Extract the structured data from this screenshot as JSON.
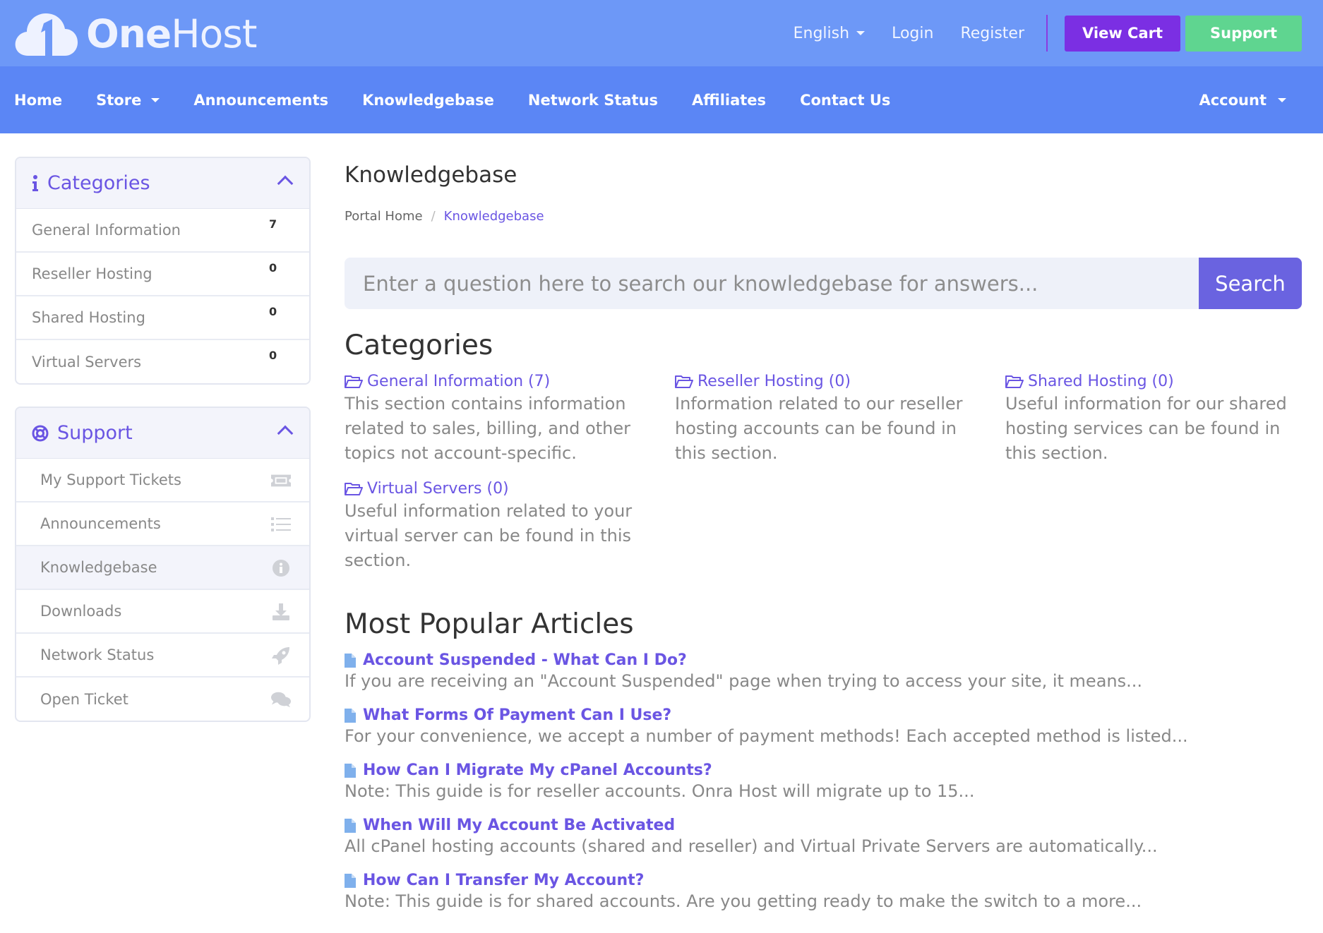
{
  "brand": {
    "name_bold": "One",
    "name_thin": "Host"
  },
  "topbar": {
    "language": "English",
    "login": "Login",
    "register": "Register",
    "view_cart": "View Cart",
    "support": "Support"
  },
  "nav": {
    "home": "Home",
    "store": "Store",
    "announcements": "Announcements",
    "knowledgebase": "Knowledgebase",
    "network_status": "Network Status",
    "affiliates": "Affiliates",
    "contact_us": "Contact Us",
    "account": "Account"
  },
  "sidebar": {
    "categories": {
      "title": "Categories",
      "items": [
        {
          "label": "General Information",
          "count": "7"
        },
        {
          "label": "Reseller Hosting",
          "count": "0"
        },
        {
          "label": "Shared Hosting",
          "count": "0"
        },
        {
          "label": "Virtual Servers",
          "count": "0"
        }
      ]
    },
    "support": {
      "title": "Support",
      "items": [
        {
          "label": "My Support Tickets",
          "icon": "ticket-icon"
        },
        {
          "label": "Announcements",
          "icon": "list-icon"
        },
        {
          "label": "Knowledgebase",
          "icon": "info-circle-icon"
        },
        {
          "label": "Downloads",
          "icon": "download-icon"
        },
        {
          "label": "Network Status",
          "icon": "rocket-icon"
        },
        {
          "label": "Open Ticket",
          "icon": "comments-icon"
        }
      ]
    }
  },
  "main": {
    "title": "Knowledgebase",
    "breadcrumb": {
      "home": "Portal Home",
      "current": "Knowledgebase"
    },
    "search": {
      "placeholder": "Enter a question here to search our knowledgebase for answers...",
      "button": "Search"
    },
    "categories_heading": "Categories",
    "categories": [
      {
        "title": "General Information (7)",
        "desc": "This section contains information related to sales, billing, and other topics not account-specific."
      },
      {
        "title": "Reseller Hosting (0)",
        "desc": "Information related to our reseller hosting accounts can be found in this section."
      },
      {
        "title": "Shared Hosting (0)",
        "desc": "Useful information for our shared hosting services can be found in this section."
      },
      {
        "title": "Virtual Servers (0)",
        "desc": "Useful information related to your virtual server can be found in this section."
      }
    ],
    "popular_heading": "Most Popular Articles",
    "articles": [
      {
        "title": "Account Suspended - What Can I Do?",
        "desc": "If you are receiving an \"Account Suspended\" page when trying to access your site, it means..."
      },
      {
        "title": "What Forms Of Payment Can I Use?",
        "desc": "For your convenience, we accept a number of payment methods! Each accepted method is listed..."
      },
      {
        "title": "How Can I Migrate My cPanel Accounts?",
        "desc": "Note: This guide is for reseller accounts.  Onra Host will migrate up to 15..."
      },
      {
        "title": "When Will My Account Be Activated",
        "desc": "All cPanel hosting accounts (shared and reseller) and Virtual Private Servers are automatically..."
      },
      {
        "title": "How Can I Transfer My Account?",
        "desc": "Note: This guide is for shared accounts.  Are you getting ready to make the switch to a more..."
      }
    ]
  },
  "colors": {
    "topbar": "#6d98f7",
    "nav": "#5b86f5",
    "accent": "#6a55e3",
    "view_cart": "#7b2fe3",
    "support": "#5fd590"
  }
}
